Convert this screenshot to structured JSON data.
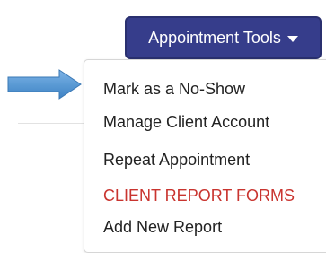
{
  "toolbar": {
    "button_label": "Appointment Tools",
    "button_caret_icon": "caret-down-icon",
    "button_color": "#363d8b"
  },
  "pointer": {
    "icon": "arrow-right-icon",
    "fill_color": "#5b9bd5"
  },
  "menu": {
    "items": [
      {
        "label": "Mark as a No-Show"
      },
      {
        "label": "Manage Client Account"
      },
      {
        "label": "Repeat Appointment"
      },
      {
        "label": "CLIENT REPORT FORMS",
        "color": "#c9342f"
      },
      {
        "label": "Add New Report"
      }
    ]
  }
}
